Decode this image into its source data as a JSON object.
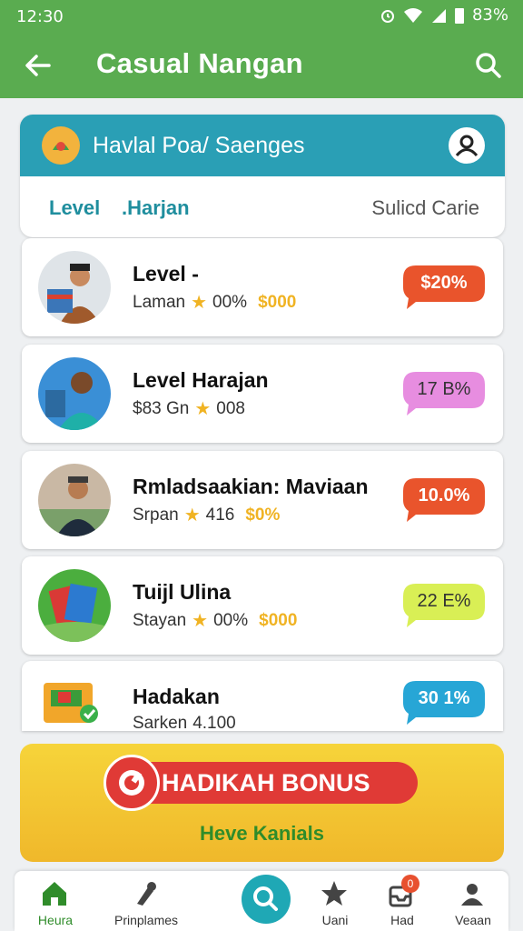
{
  "status": {
    "time": "12:30",
    "battery_text": "83%"
  },
  "appbar": {
    "title": "Casual Nangan"
  },
  "header_card": {
    "title": "Havlal Poa/ Saenges",
    "col_left_1": "Level",
    "col_left_2": ".Harjan",
    "col_right": "Sulicd Carie"
  },
  "items": [
    {
      "name": "Level -",
      "meta_label": "Laman",
      "meta_value": "00%",
      "money": "$000",
      "badge": "$20%",
      "badge_color": "#e9542c",
      "badge_text_color": "#ffffff"
    },
    {
      "name": "Level Harajan",
      "meta_label": "$83 Gn",
      "meta_value": "008",
      "money": "",
      "badge": "17 B%",
      "badge_color": "#e78de0",
      "badge_text_color": "#333333"
    },
    {
      "name": "Rmladsaakian: Maviaan",
      "meta_label": "Srpan",
      "meta_value": "416",
      "money": "$0%",
      "badge": "10.0%",
      "badge_color": "#e9542c",
      "badge_text_color": "#ffffff"
    },
    {
      "name": "Tuijl Ulina",
      "meta_label": "Stayan",
      "meta_value": "00%",
      "money": "$000",
      "badge": "22 E%",
      "badge_color": "#d9ef55",
      "badge_text_color": "#333333"
    },
    {
      "name": "Hadakan",
      "meta_label": "Sarken",
      "meta_value": "4.100",
      "money": "",
      "badge": "30 1%",
      "badge_color": "#27a6d6",
      "badge_text_color": "#ffffff"
    }
  ],
  "bonus": {
    "title": "HADIKAH BONUS",
    "subtitle": "Heve Kanials"
  },
  "nav": {
    "tabs": [
      {
        "label": "Heura"
      },
      {
        "label": "Prinplames"
      },
      {
        "label": "Uani"
      },
      {
        "label": "Had",
        "badge": "0"
      },
      {
        "label": "Veaan"
      }
    ]
  },
  "colors": {
    "appbar": "#5aac50",
    "card_header": "#2a9fb5",
    "accent_green": "#2f8c2a",
    "star": "#f0b323"
  }
}
